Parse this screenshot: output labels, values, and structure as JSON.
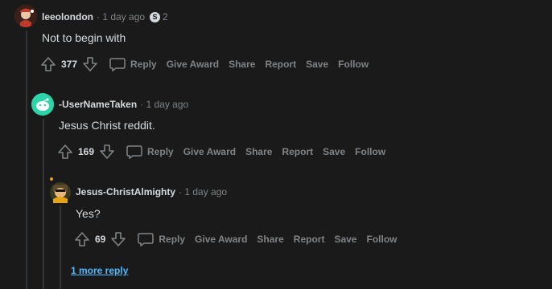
{
  "comments": [
    {
      "author": "leeolondon",
      "time": "· 1 day ago",
      "badge_icon": "S",
      "badge_count": "2",
      "body": "Not to begin with",
      "votes": "377",
      "actions": {
        "reply": "Reply",
        "award": "Give Award",
        "share": "Share",
        "report": "Report",
        "save": "Save",
        "follow": "Follow"
      },
      "avatar_color": "#5a3a2a"
    },
    {
      "author": "-UserNameTaken",
      "time": "· 1 day ago",
      "body": "Jesus Christ reddit.",
      "votes": "169",
      "actions": {
        "reply": "Reply",
        "award": "Give Award",
        "share": "Share",
        "report": "Report",
        "save": "Save",
        "follow": "Follow"
      },
      "avatar_color": "#2dd4a7"
    },
    {
      "author": "Jesus-ChristAlmighty",
      "time": "· 1 day ago",
      "body": "Yes?",
      "votes": "69",
      "actions": {
        "reply": "Reply",
        "award": "Give Award",
        "share": "Share",
        "report": "Report",
        "save": "Save",
        "follow": "Follow"
      },
      "avatar_color": "#3a3a20"
    }
  ],
  "more_replies": "1 more reply",
  "colors": {
    "background": "#1a1a1b",
    "text": "#d7dadc",
    "muted": "#818384",
    "link": "#4fbcff",
    "thread": "#343536"
  }
}
